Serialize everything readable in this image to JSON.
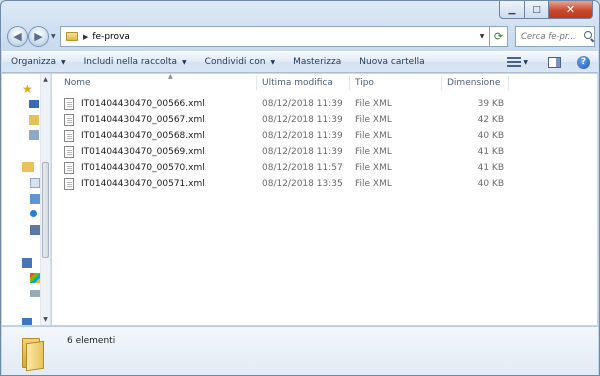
{
  "window": {
    "caption": {
      "minimize": "▁",
      "maximize": "□",
      "close": "✕"
    }
  },
  "address": {
    "path_segment": "fe-prova",
    "search_placeholder": "Cerca fe-pr..."
  },
  "commands": {
    "organize": "Organizza",
    "include": "Includi nella raccolta",
    "share": "Condividi con",
    "burn": "Masterizza",
    "new_folder": "Nuova cartella"
  },
  "columns": {
    "name": "Nome",
    "modified": "Ultima modifica",
    "type": "Tipo",
    "size": "Dimensione"
  },
  "files": [
    {
      "name": "IT01404430470_00566.xml",
      "modified": "08/12/2018 11:39",
      "type": "File XML",
      "size": "39 KB"
    },
    {
      "name": "IT01404430470_00567.xml",
      "modified": "08/12/2018 11:39",
      "type": "File XML",
      "size": "42 KB"
    },
    {
      "name": "IT01404430470_00568.xml",
      "modified": "08/12/2018 11:39",
      "type": "File XML",
      "size": "40 KB"
    },
    {
      "name": "IT01404430470_00569.xml",
      "modified": "08/12/2018 11:39",
      "type": "File XML",
      "size": "41 KB"
    },
    {
      "name": "IT01404430470_00570.xml",
      "modified": "08/12/2018 11:57",
      "type": "File XML",
      "size": "41 KB"
    },
    {
      "name": "IT01404430470_00571.xml",
      "modified": "08/12/2018 13:35",
      "type": "File XML",
      "size": "40 KB"
    }
  ],
  "status": {
    "item_count": "6 elementi"
  },
  "icons": {
    "nav_pane": [
      "favorites-star-icon",
      "desktop-icon",
      "downloads-icon",
      "recent-places-icon",
      "libraries-icon",
      "documents-icon",
      "pictures-icon",
      "music-icon",
      "videos-icon",
      "homegroup-icon",
      "computer-icon",
      "drive-icon",
      "network-drive-icon",
      "network-icon"
    ]
  },
  "colors": {
    "frame": "#c7d9ee",
    "command_text": "#1e395b",
    "header_text": "#4c607a",
    "folder": "#e9c25a"
  }
}
